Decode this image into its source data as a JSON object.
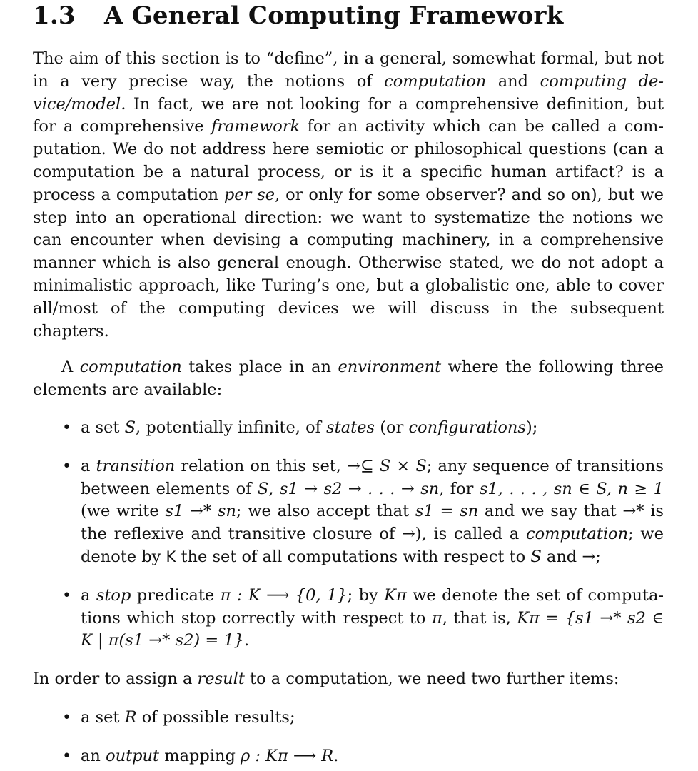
{
  "section": {
    "number": "1.3",
    "title": "A General Computing Framework"
  },
  "paragraphs": {
    "intro": {
      "t1": "The aim of this section is to “define”, in a general, somewhat formal, but not in a very precise way, the notions of ",
      "e1": "computation",
      "t2": " and ",
      "e2": "computing de­vice/model.",
      "t3": " In fact, we are not looking for a comprehensive definition, but for a comprehensive ",
      "e3": "framework",
      "t4": " for an activity which can be called a com­putation. We do not address here semiotic or philosophical questions (can a computation be a natural process, or is it a specific human artifact? is a process a computation ",
      "e4": "per se",
      "t5": ", or only for some observer? and so on), but we step into an operational direction: we want to systematize the notions we can encounter when devising a computing machinery, in a comprehensive manner which is also general enough. Otherwise stated, we do not adopt a minimalistic approach, like Turing’s one, but a globalistic one, able to cover all/most of the computing devices we will discuss in the subsequent chapters."
    },
    "environment": {
      "t1": "A ",
      "e1": "computation",
      "t2": " takes place in an ",
      "e2": "environment",
      "t3": " where the following three elements are available:"
    },
    "result": {
      "t1": "In order to assign a ",
      "e1": "result",
      "t2": " to a computation, we need two further items:"
    }
  },
  "elements_list": {
    "states": {
      "t1": "a set ",
      "m1": "S",
      "t2": ", potentially infinite, of ",
      "e1": "states",
      "t3": " (or ",
      "e2": "configurations",
      "t4": ");"
    },
    "transition": {
      "t1": "a ",
      "e1": "transition",
      "t2": " relation on this set, →⊆ ",
      "m1": "S",
      "t3": " × ",
      "m2": "S",
      "t4": "; any sequence of transitions between elements of ",
      "m3": "S",
      "t5": ", ",
      "chain": "s1 → s2 → . . . → sn",
      "t6": ", for ",
      "range": "s1, . . . , sn ∈ S, n ≥ 1",
      "t7": " (we write ",
      "star1": "s1 →* sn",
      "t8": "; we also accept that ",
      "eq": "s1 = sn",
      "t9": " and we say that →* is the reflexive and transitive closure of →), is called a ",
      "e2": "computation",
      "t10": "; we denote by ",
      "k": "K",
      "t11": " the set of all computations with respect to ",
      "m4": "S",
      "t12": " and →;"
    },
    "stop": {
      "t1": "a ",
      "e1": "stop",
      "t2": " predicate ",
      "f": "π : K ⟶ {0, 1}",
      "t3": "; by ",
      "kpi": "Kπ",
      "t4": " we denote the set of computa­tions which stop correctly with respect to ",
      "pi": "π",
      "t5": ", that is, ",
      "def": "Kπ = {s1 →* s2 ∈ K | π(s1 →* s2) = 1}",
      "t6": "."
    }
  },
  "result_list": {
    "results": {
      "t1": "a set ",
      "m1": "R",
      "t2": " of possible results;"
    },
    "output": {
      "t1": "an ",
      "e1": "output",
      "t2": " mapping ",
      "f": "ρ : Kπ ⟶ R",
      "t3": "."
    }
  },
  "bullet_glyph": "•"
}
